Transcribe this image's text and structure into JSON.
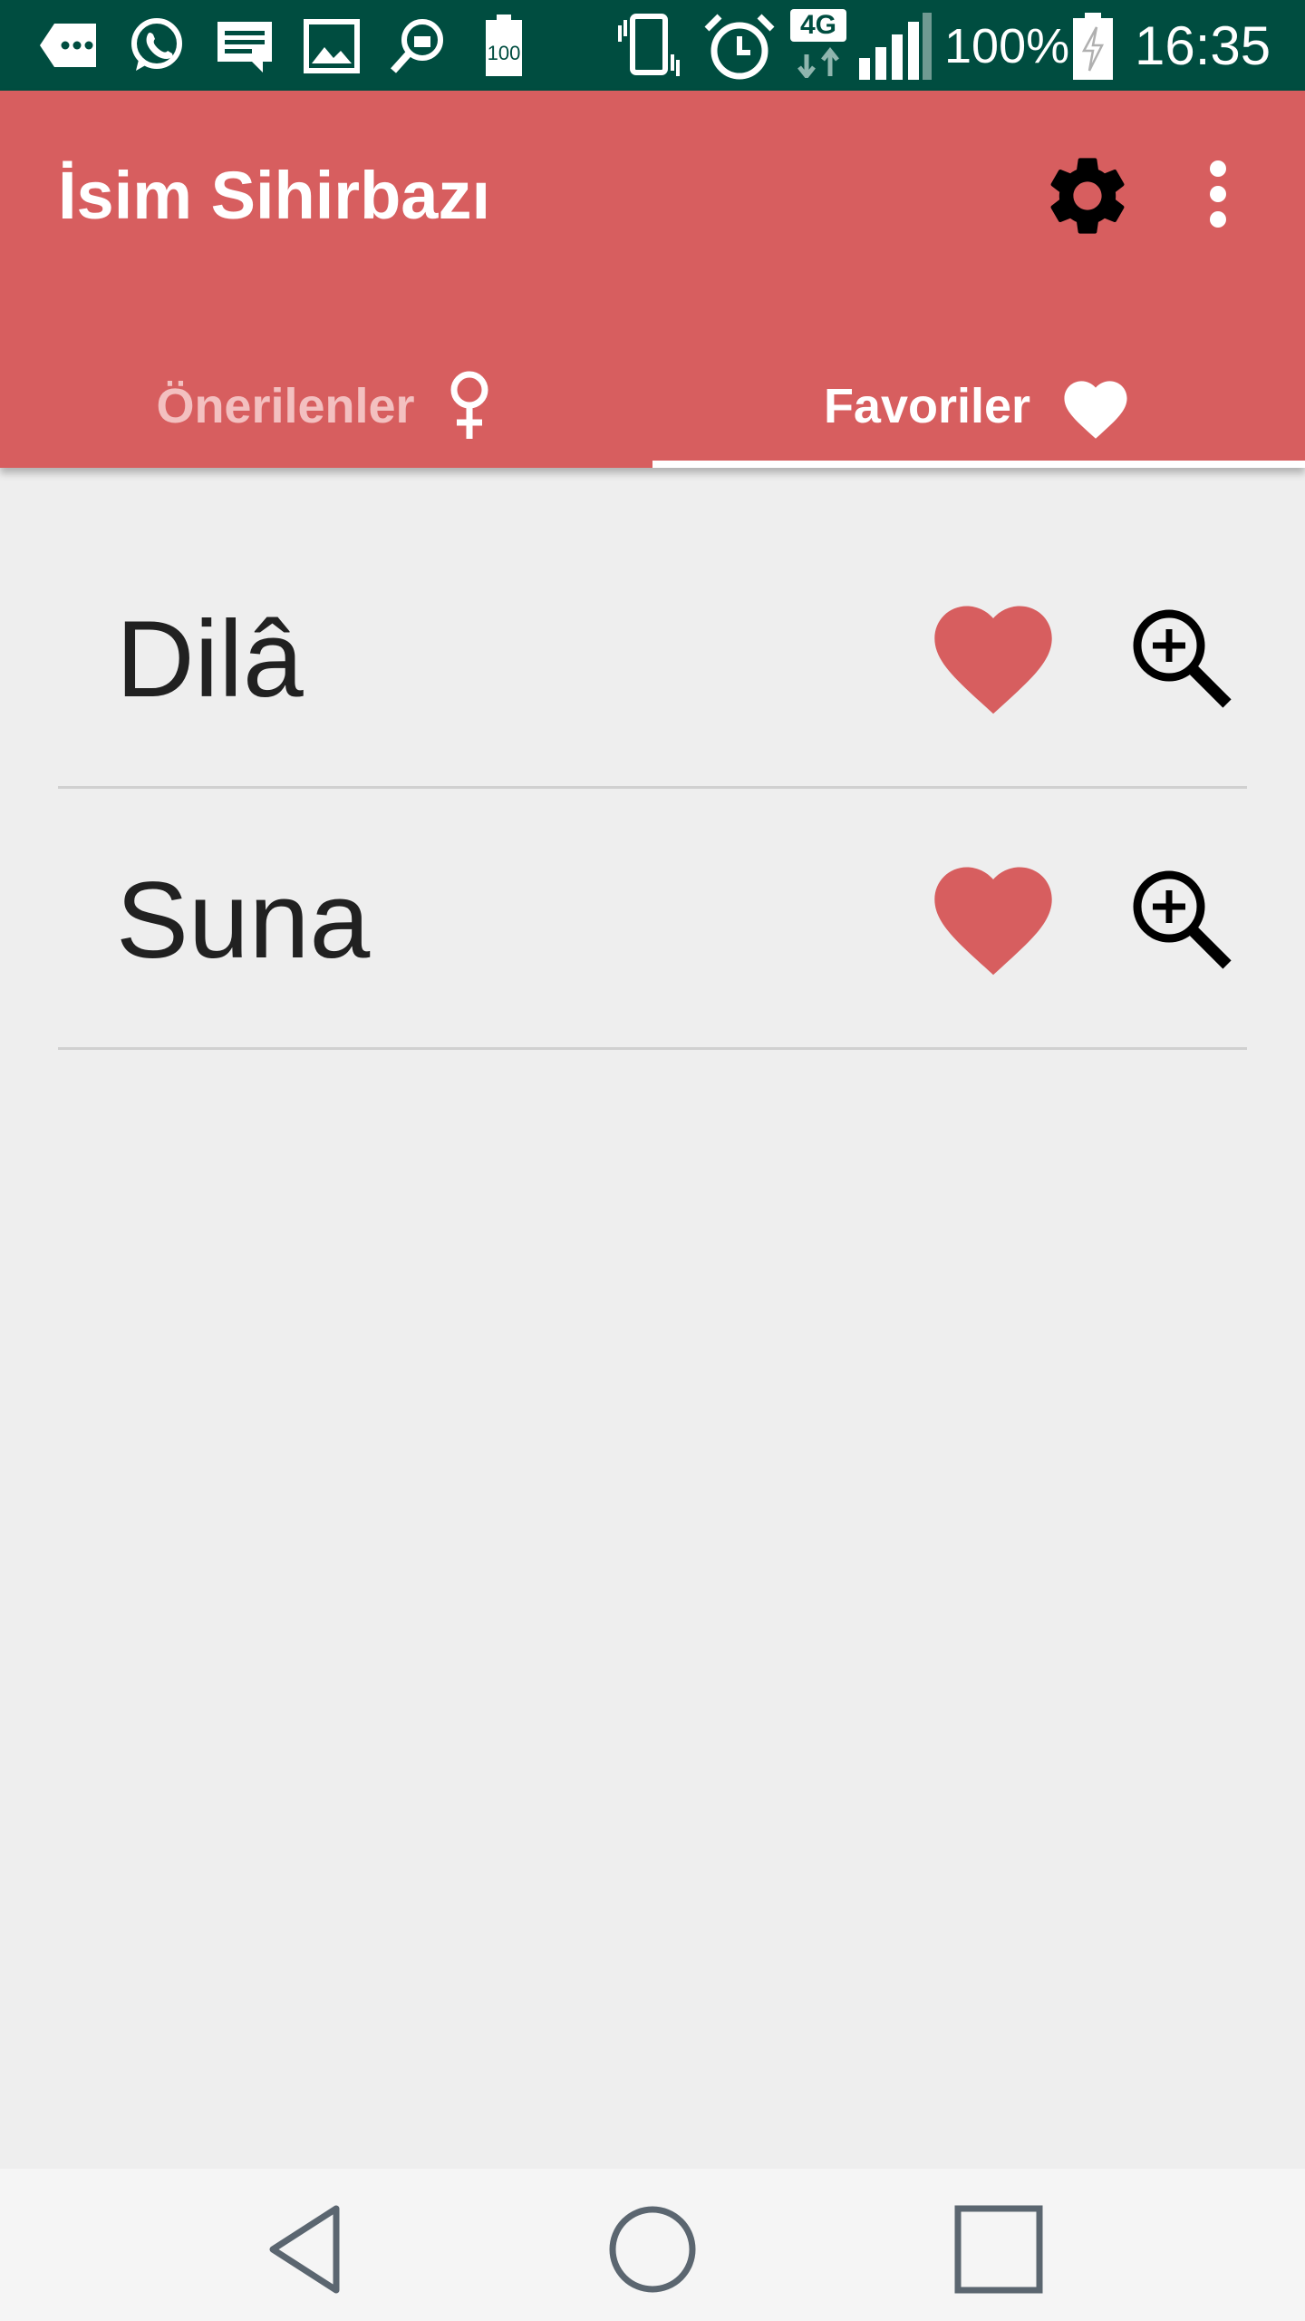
{
  "status_bar": {
    "battery_percent": "100%",
    "time": "16:35",
    "network_type": "4G",
    "icons": [
      "more-notifications-icon",
      "whatsapp-icon",
      "message-icon",
      "image-icon",
      "search-briefcase-icon",
      "battery-100-icon",
      "vibrate-icon",
      "alarm-icon",
      "network-4g-icon",
      "signal-icon",
      "battery-charging-icon"
    ]
  },
  "app_bar": {
    "title": "İsim Sihirbazı",
    "actions": [
      "settings-icon",
      "more-vert-icon"
    ],
    "color": "#d75e5f"
  },
  "tabs": [
    {
      "label": "Önerilenler",
      "icon": "female-icon",
      "selected": false
    },
    {
      "label": "Favoriler",
      "icon": "heart-icon",
      "selected": true
    }
  ],
  "favorites": [
    {
      "name": "Dilâ"
    },
    {
      "name": "Suna"
    }
  ],
  "colors": {
    "accent": "#d75e5f",
    "status_bar": "#004d40",
    "background": "#eeeeee"
  }
}
